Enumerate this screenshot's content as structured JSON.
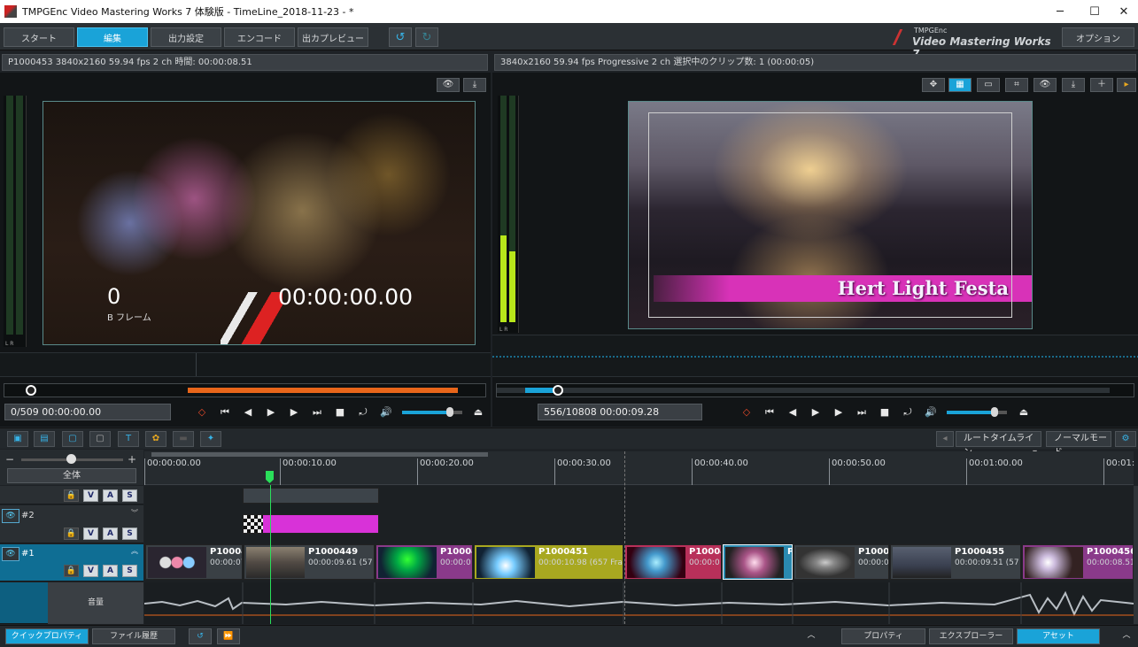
{
  "window": {
    "title": "TMPGEnc Video Mastering Works 7 体験版 - TimeLine_2018-11-23 - *",
    "min": "─",
    "max": "☐",
    "close": "✕"
  },
  "toolbar": {
    "tabs": [
      "スタート",
      "編集",
      "出力設定",
      "エンコード",
      "出カプレビュー"
    ],
    "active_tab": "編集",
    "undo_icon": "↺",
    "redo_icon": "↻",
    "brand_top": "TMPGEnc",
    "brand_main": "Video Mastering Works 7",
    "options": "オプション"
  },
  "left_pane": {
    "info": "P1000453  3840x2160 59.94 fps 2 ch  時間: 00:00:08.51",
    "frame_number": "0",
    "frame_type": "B フレーム",
    "timecode_overlay": "00:00:00.00",
    "position": "0/509  00:00:00.00",
    "meter_label": "L  R",
    "seek_progress": 0.0,
    "range_start": 0.38,
    "range_end": 0.94,
    "volume": 0.8
  },
  "right_pane": {
    "info": "3840x2160 59.94 fps Progressive 2 ch  選択中のクリップ数:  1 (00:00:05)",
    "overlay_title": "Hert Light Festa",
    "position": "556/10808  00:00:09.28",
    "meter_label": "L  R",
    "seek_progress": 0.05,
    "volume": 0.8
  },
  "transport": {
    "mark": "◇",
    "prev_mark": "⏮",
    "step_back": "◀",
    "play": "▶",
    "step_fwd": "▶",
    "next_mark": "⏭",
    "stop": "■",
    "loop": "⤾",
    "speaker": "🔊",
    "eject": "⏏"
  },
  "timeline_tools": {
    "root_timeline": "ルートタイムライン",
    "normal_mode": "ノーマルモード",
    "zoom_all": "全体",
    "zoom_minus": "−",
    "zoom_plus": "+"
  },
  "ruler": {
    "labels": [
      "00:00:00.00",
      "00:00:10.00",
      "00:00:20.00",
      "00:00:30.00",
      "00:00:40.00",
      "00:00:50.00",
      "00:01:00.00",
      "00:01:"
    ]
  },
  "tracks": {
    "track2": {
      "name": "#2"
    },
    "track1": {
      "name": "#1"
    },
    "audio": {
      "name": "音量"
    },
    "btn_v": "V",
    "btn_a": "A",
    "btn_s": "S"
  },
  "clips": [
    {
      "name": "P1000448",
      "detail": "00:00:07"
    },
    {
      "name": "P1000449",
      "detail": "00:00:09.61 (57"
    },
    {
      "name": "P10004",
      "detail": "00:00:0"
    },
    {
      "name": "P1000451",
      "detail": "00:00:10.98 (657 Fra"
    },
    {
      "name": "P10004",
      "detail": "00:00:0"
    },
    {
      "name": "P",
      "detail": ""
    },
    {
      "name": "P10004",
      "detail": "00:00:0"
    },
    {
      "name": "P1000455",
      "detail": "00:00:09.51 (57"
    },
    {
      "name": "P1000456",
      "detail": "00:00:08.51"
    }
  ],
  "bottom": {
    "quick_property": "クイックプロパティ",
    "file_history": "ファイル履歴",
    "property": "プロパティ",
    "explorer": "エクスプローラー",
    "asset": "アセット",
    "collapse": "︿"
  },
  "colors": {
    "accent": "#1aa3d8",
    "range": "#e8661a",
    "playhead": "#2adf5a",
    "clip_pink": "#d832d8",
    "clip_yellow": "#a8a820",
    "clip_red": "#b8305a",
    "clip_purple": "#8a3a8a"
  }
}
